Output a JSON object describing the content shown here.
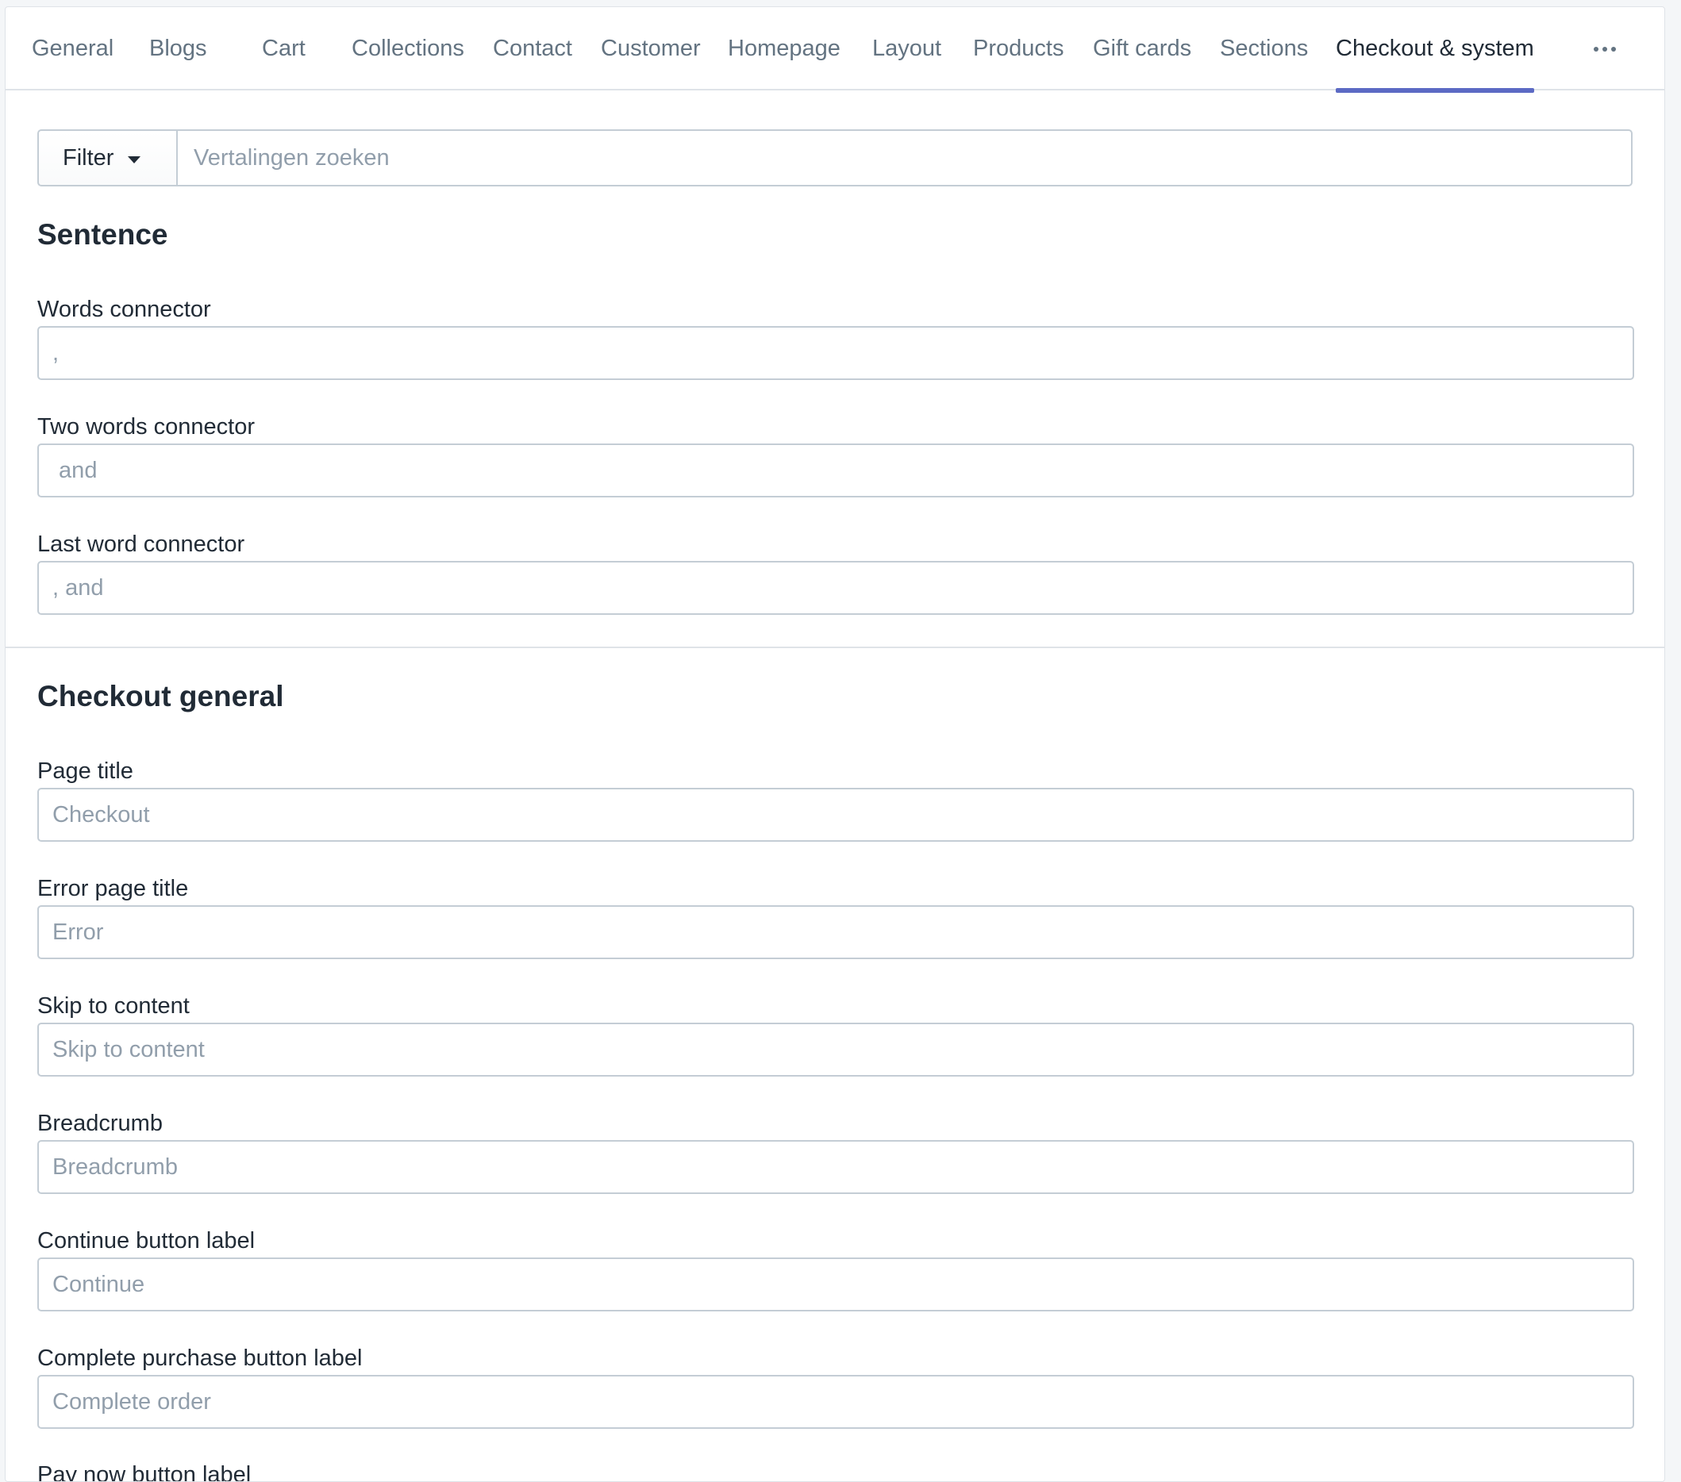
{
  "tabs": [
    {
      "label": "General"
    },
    {
      "label": "Blogs"
    },
    {
      "label": "Cart"
    },
    {
      "label": "Collections"
    },
    {
      "label": "Contact"
    },
    {
      "label": "Customer"
    },
    {
      "label": "Homepage"
    },
    {
      "label": "Layout"
    },
    {
      "label": "Products"
    },
    {
      "label": "Gift cards"
    },
    {
      "label": "Sections"
    },
    {
      "label": "Checkout & system",
      "active": true
    }
  ],
  "more_icon": "horizontal-dots-icon",
  "filter": {
    "button_label": "Filter",
    "search_placeholder": "Vertalingen zoeken"
  },
  "sentence": {
    "title": "Sentence",
    "fields": [
      {
        "label": "Words connector",
        "placeholder": ","
      },
      {
        "label": "Two words connector",
        "placeholder": " and"
      },
      {
        "label": "Last word connector",
        "placeholder": ", and"
      }
    ]
  },
  "checkout_general": {
    "title": "Checkout general",
    "fields": [
      {
        "label": "Page title",
        "placeholder": "Checkout"
      },
      {
        "label": "Error page title",
        "placeholder": "Error"
      },
      {
        "label": "Skip to content",
        "placeholder": "Skip to content"
      },
      {
        "label": "Breadcrumb",
        "placeholder": "Breadcrumb"
      },
      {
        "label": "Continue button label",
        "placeholder": "Continue"
      },
      {
        "label": "Complete purchase button label",
        "placeholder": "Complete order"
      },
      {
        "label": "Pay now button label",
        "placeholder": ""
      }
    ]
  },
  "colors": {
    "accent": "#5c6ac4",
    "text": "#212b36",
    "muted": "#637381",
    "placeholder": "#919eab",
    "border": "#c4cdd5"
  }
}
